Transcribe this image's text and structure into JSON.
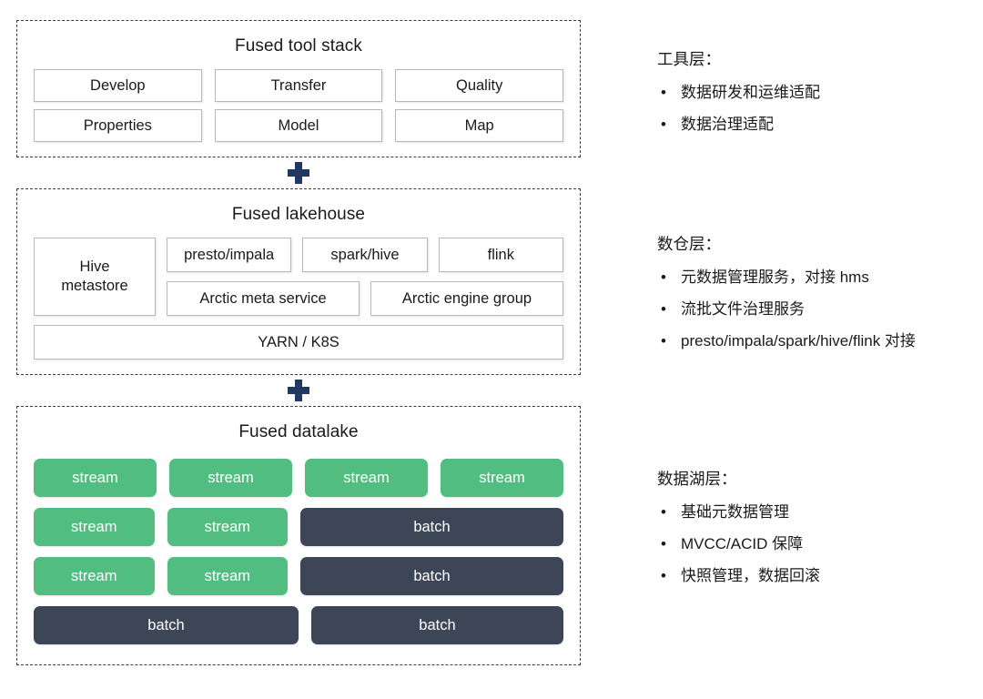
{
  "diagram": {
    "layers": [
      {
        "id": "tool-stack",
        "title": "Fused tool stack",
        "boxes": [
          "Develop",
          "Transfer",
          "Quality",
          "Properties",
          "Model",
          "Map"
        ]
      },
      {
        "id": "lakehouse",
        "title": "Fused lakehouse",
        "metastore": "Hive\nmetastore",
        "metastore_line1": "Hive",
        "metastore_line2": "metastore",
        "engines": [
          "presto/impala",
          "spark/hive",
          "flink"
        ],
        "services": [
          "Arctic meta service",
          "Arctic engine group"
        ],
        "resource": "YARN / K8S"
      },
      {
        "id": "datalake",
        "title": "Fused datalake",
        "rows": [
          [
            {
              "label": "stream",
              "kind": "stream",
              "flex": 1
            },
            {
              "label": "stream",
              "kind": "stream",
              "flex": 1
            },
            {
              "label": "stream",
              "kind": "stream",
              "flex": 1
            },
            {
              "label": "stream",
              "kind": "stream",
              "flex": 1
            }
          ],
          [
            {
              "label": "stream",
              "kind": "stream",
              "flex": 1
            },
            {
              "label": "stream",
              "kind": "stream",
              "flex": 1
            },
            {
              "label": "batch",
              "kind": "batch",
              "flex": 2.18
            }
          ],
          [
            {
              "label": "stream",
              "kind": "stream",
              "flex": 1
            },
            {
              "label": "stream",
              "kind": "stream",
              "flex": 1
            },
            {
              "label": "batch",
              "kind": "batch",
              "flex": 2.18
            }
          ],
          [
            {
              "label": "batch",
              "kind": "batch",
              "flex": 1.05
            },
            {
              "label": "batch",
              "kind": "batch",
              "flex": 1.0
            }
          ]
        ]
      }
    ],
    "connector_icon": "plus-icon"
  },
  "notes": [
    {
      "id": "tool-layer",
      "title": "工具层：",
      "items": [
        "数据研发和运维适配",
        "数据治理适配"
      ]
    },
    {
      "id": "warehouse-layer",
      "title": "数仓层：",
      "items": [
        "元数据管理服务，对接 hms",
        "流批文件治理服务",
        "presto/impala/spark/hive/flink 对接"
      ]
    },
    {
      "id": "datalake-layer",
      "title": "数据湖层：",
      "items": [
        "基础元数据管理",
        "MVCC/ACID 保障",
        "快照管理，数据回滚"
      ]
    }
  ],
  "colors": {
    "stream": "#52bd80",
    "batch": "#3d4657",
    "plus": "#1f3864",
    "layer_border": "#3c3c3c",
    "box_border": "#b8b8b8"
  },
  "bullet_glyph": "•"
}
